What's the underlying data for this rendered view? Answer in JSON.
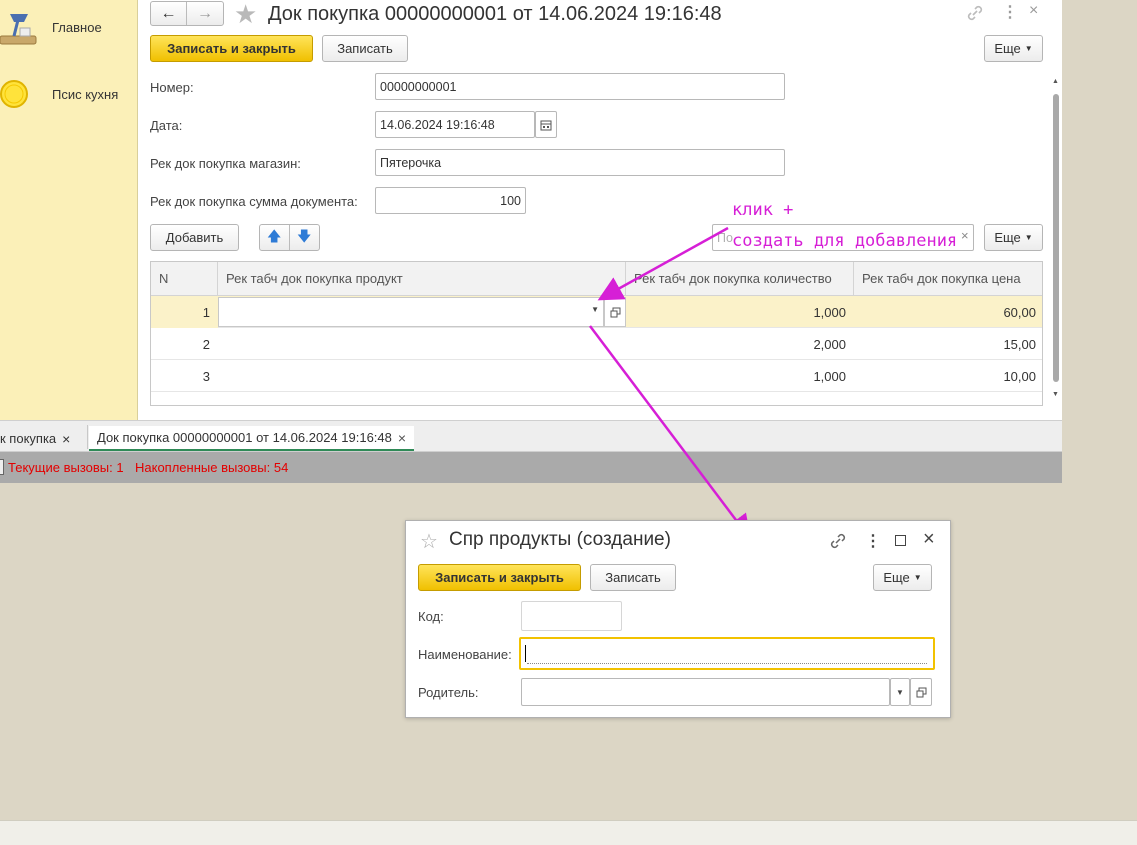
{
  "sidebar": {
    "items": [
      {
        "label": "Главное",
        "icon": "desk-lamp-icon"
      },
      {
        "label": "Псис кухня",
        "icon": "yellow-circle-icon"
      }
    ]
  },
  "form": {
    "title": "Док покупка 00000000001 от 14.06.2024 19:16:48",
    "toolbar": {
      "save_close": "Записать и закрыть",
      "save": "Записать",
      "more": "Еще"
    },
    "fields": {
      "number_label": "Номер:",
      "number_value": "00000000001",
      "date_label": "Дата:",
      "date_value": "14.06.2024 19:16:48",
      "shop_label": "Рек док покупка магазин:",
      "shop_value": "Пятерочка",
      "sum_label": "Рек док покупка сумма документа:",
      "sum_value": "100"
    },
    "table_toolbar": {
      "add": "Добавить",
      "search_placeholder": "По",
      "more": "Еще"
    },
    "table": {
      "headers": [
        "N",
        "Рек табч док покупка продукт",
        "Рек табч док покупка количество",
        "Рек табч док покупка цена"
      ],
      "rows": [
        {
          "n": "1",
          "product": "",
          "qty": "1,000",
          "price": "60,00"
        },
        {
          "n": "2",
          "product": "",
          "qty": "2,000",
          "price": "15,00"
        },
        {
          "n": "3",
          "product": "",
          "qty": "1,000",
          "price": "10,00"
        }
      ]
    }
  },
  "tabs": {
    "tab1": "к покупка",
    "tab2": "Док покупка 00000000001 от 14.06.2024 19:16:48"
  },
  "status": {
    "current": "Текущие вызовы: 1",
    "accumulated": "Накопленные вызовы: 54"
  },
  "annotation": {
    "line1": "клик +",
    "line2": "создать для добавления",
    "color": "#d61fd6"
  },
  "dialog": {
    "title": "Спр продукты (создание)",
    "save_close": "Записать и закрыть",
    "save": "Записать",
    "more": "Еще",
    "code_label": "Код:",
    "code_value": "",
    "name_label": "Наименование:",
    "name_value": "",
    "parent_label": "Родитель:",
    "parent_value": ""
  },
  "colors": {
    "primary_button": "#f0c000",
    "sidebar_bg": "#fbf0b8",
    "selected_row": "#fbf2c9",
    "status_text": "#e30000"
  }
}
